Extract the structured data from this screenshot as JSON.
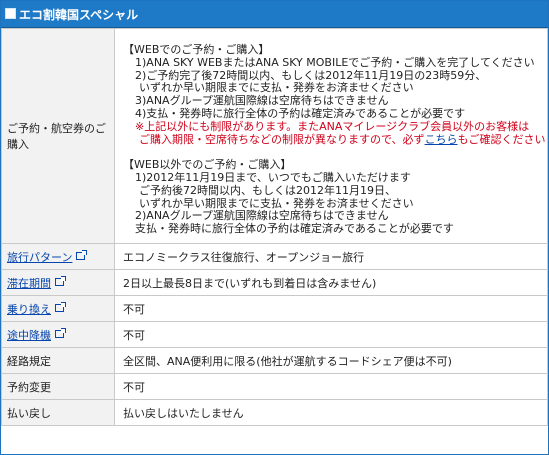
{
  "header": {
    "title": "エコ割韓国スペシャル"
  },
  "purchase": {
    "label_line1": "ご予約・航空券のご",
    "label_line2": "購入",
    "web_heading": "【WEBでのご予約・ご購入】",
    "web_lines": [
      "1)ANA SKY WEBまたはANA SKY MOBILEでご予約・ご購入を完了してください",
      "2)ご予約完了後72時間以内、もしくは2012年11月19日の23時59分、",
      "いずれか早い期限までに支払・発券をお済ませください",
      "3)ANAグループ運航国際線は空席待ちはできません",
      "4)支払・発券時に旅行全体の予約は確定済みであることが必要です"
    ],
    "note_line1": "※上記以外にも制限があります。またANAマイレージクラブ会員以外のお客様は",
    "note_line2_prefix": "ご購入期限・空席待ちなどの制限が異なりますので、必ず",
    "note_link": "こちら",
    "note_line2_suffix": "もご確認ください",
    "other_heading": "【WEB以外でのご予約・ご購入】",
    "other_lines": [
      "1)2012年11月19日まで、いつでもご購入いただけます",
      "ご予約後72時間以内、もしくは2012年11月19日、",
      "いずれか早い期限までに支払・発券をお済ませください",
      "2)ANAグループ運航国際線は空席待ちはできません",
      "支払・発券時に旅行全体の予約は確定済みであることが必要です"
    ]
  },
  "rows": [
    {
      "label": "旅行パターン",
      "value": "エコノミークラス往復旅行、オープンジョー旅行",
      "link": true
    },
    {
      "label": "滞在期間",
      "value": "2日以上最長8日まで(いずれも到着日は含みません)",
      "link": true
    },
    {
      "label": "乗り換え",
      "value": "不可",
      "link": true
    },
    {
      "label": "途中降機",
      "value": "不可",
      "link": true
    },
    {
      "label": "経路規定",
      "value": "全区間、ANA便利用に限る(他社が運航するコードシェア便は不可)",
      "link": false
    },
    {
      "label": "予約変更",
      "value": "不可",
      "link": false
    },
    {
      "label": "払い戻し",
      "value": "払い戻しはいたしません",
      "link": false
    }
  ],
  "colors": {
    "header_bg": "#1e7ac6",
    "label_bg": "#f2f2f2",
    "notice_red": "#d0021b",
    "link": "#0645ad"
  },
  "icons": {
    "header": "square-bullet-icon",
    "link": "external-window-icon"
  }
}
